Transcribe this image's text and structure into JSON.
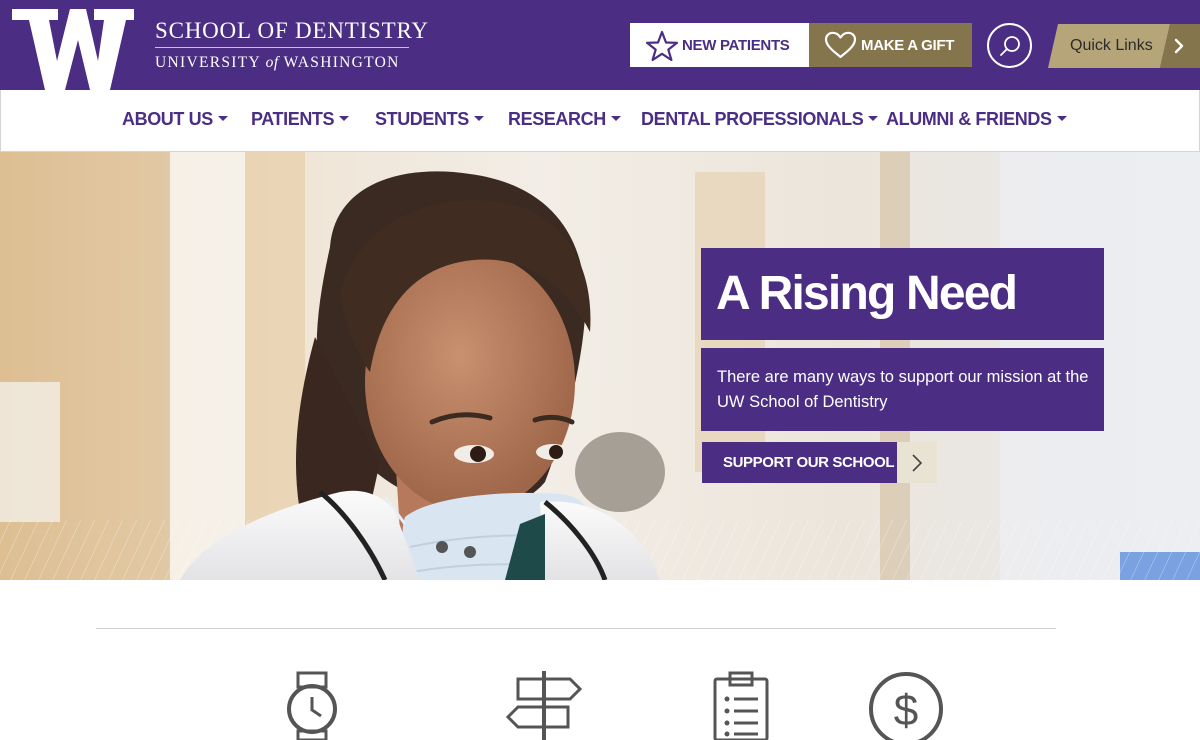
{
  "header": {
    "logo_letter": "W",
    "school_line1": "SCHOOL OF DENTISTRY",
    "school_line2_part1": "UNIVERSITY",
    "school_line2_of": "of",
    "school_line2_part2": "WASHINGTON",
    "new_patients_label": "NEW PATIENTS",
    "make_gift_label": "MAKE A GIFT",
    "search_icon": "search-icon",
    "quick_links_label": "Quick Links",
    "colors": {
      "purple": "#4b2e83",
      "gold": "#85754d",
      "tan": "#b7a57a"
    }
  },
  "nav": {
    "items": [
      {
        "label": "ABOUT US"
      },
      {
        "label": "PATIENTS"
      },
      {
        "label": "STUDENTS"
      },
      {
        "label": "RESEARCH"
      },
      {
        "label": "DENTAL PROFESSIONALS"
      },
      {
        "label": "ALUMNI & FRIENDS"
      }
    ]
  },
  "hero": {
    "title": "A Rising Need",
    "text": "There are many ways to support our mission at the UW School of Dentistry",
    "cta_label": "SUPPORT OUR SCHOOL"
  },
  "features": {
    "icons": [
      "watch-icon",
      "signpost-icon",
      "clipboard-icon",
      "dollar-icon"
    ]
  }
}
